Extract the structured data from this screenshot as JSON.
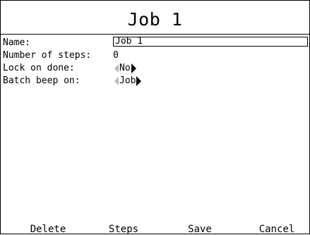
{
  "screen": {
    "title": "Job 1"
  },
  "form": {
    "name_label": "Name:",
    "name_value": "Job 1",
    "steps_label": "Number of steps:",
    "steps_value": "0",
    "lock_label": "Lock on done:",
    "lock_value": "No",
    "beep_label": "Batch beep on:",
    "beep_value": "Job"
  },
  "softkeys": {
    "delete": "Delete",
    "steps": "Steps",
    "save": "Save",
    "cancel": "Cancel"
  },
  "icons": {
    "left_arrow": "triangle-left",
    "right_arrow": "triangle-right"
  },
  "colors": {
    "background": "#ffffff",
    "foreground": "#000000",
    "disabled_arrow": "#b8b8b8"
  }
}
